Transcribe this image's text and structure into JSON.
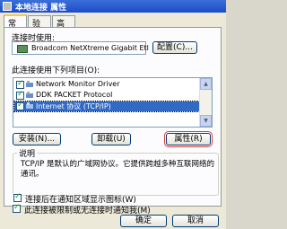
{
  "window": {
    "title": "本地连接 属性"
  },
  "tabs": [
    {
      "label": "常规"
    },
    {
      "label": "验证"
    },
    {
      "label": "高级"
    }
  ],
  "connect_using": {
    "label": "连接时使用:",
    "adapter": "Broadcom NetXtreme Gigabit Etl",
    "configure_button": "配置(C)..."
  },
  "components": {
    "label": "此连接使用下列项目(O):",
    "items": [
      {
        "label": "Network Monitor Driver",
        "checked": true,
        "selected": false
      },
      {
        "label": "DDK PACKET Protocol",
        "checked": true,
        "selected": false
      },
      {
        "label": "Internet 协议 (TCP/IP)",
        "checked": true,
        "selected": true
      }
    ]
  },
  "buttons": {
    "install": "安装(N)...",
    "uninstall": "卸载(U)",
    "properties": "属性(R)",
    "ok": "确定",
    "cancel": "取消"
  },
  "description": {
    "title": "说明",
    "text": "TCP/IP 是默认的广域网协议。它提供跨越多种互联网络的通讯。"
  },
  "options": [
    {
      "label": "连接后在通知区域显示图标(W)",
      "checked": true
    },
    {
      "label": "此连接被限制或无连接时通知我(M)",
      "checked": true
    }
  ],
  "colors": {
    "titlebar": "#1c4cc7",
    "selection": "#316ac5",
    "tab_highlight": "#ffc83c"
  }
}
